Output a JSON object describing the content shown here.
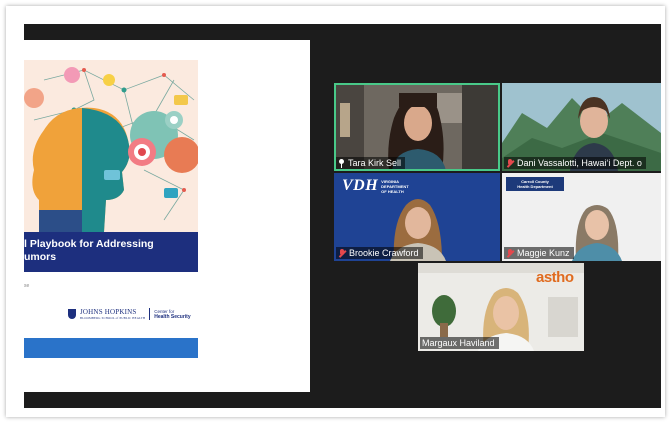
{
  "slide": {
    "cover_title_line1": "l Playbook for Addressing",
    "cover_title_line2": "umors",
    "byline": "se",
    "institution_name": "JOHNS HOPKINS",
    "institution_sub": "BLOOMBERG SCHOOL of PUBLIC HEALTH",
    "center_line1": "Center for",
    "center_line2": "Health Security"
  },
  "participants": [
    {
      "name": "Tara Kirk Sell",
      "pinned": true,
      "muted": false,
      "active": true
    },
    {
      "name": "Dani Vassalotti, Hawaiʻi Dept. o",
      "pinned": false,
      "muted": true,
      "active": false
    },
    {
      "name": "Brookie Crawford",
      "pinned": false,
      "muted": true,
      "active": false,
      "logo": {
        "big": "VDH",
        "small1": "VIRGINIA",
        "small2": "DEPARTMENT",
        "small3": "OF HEALTH"
      }
    },
    {
      "name": "Maggie Kunz",
      "pinned": false,
      "muted": true,
      "active": false,
      "logo": {
        "line1": "Carroll County",
        "line2": "Health Department"
      }
    },
    {
      "name": "Margaux Haviland",
      "pinned": false,
      "muted": false,
      "active": false,
      "logo": {
        "text": "astho"
      }
    }
  ],
  "colors": {
    "meeting_bg": "#1c1c1c",
    "active_speaker": "#49c989",
    "muted_mic": "#e5484d",
    "cover_band": "#1d2f7e"
  }
}
